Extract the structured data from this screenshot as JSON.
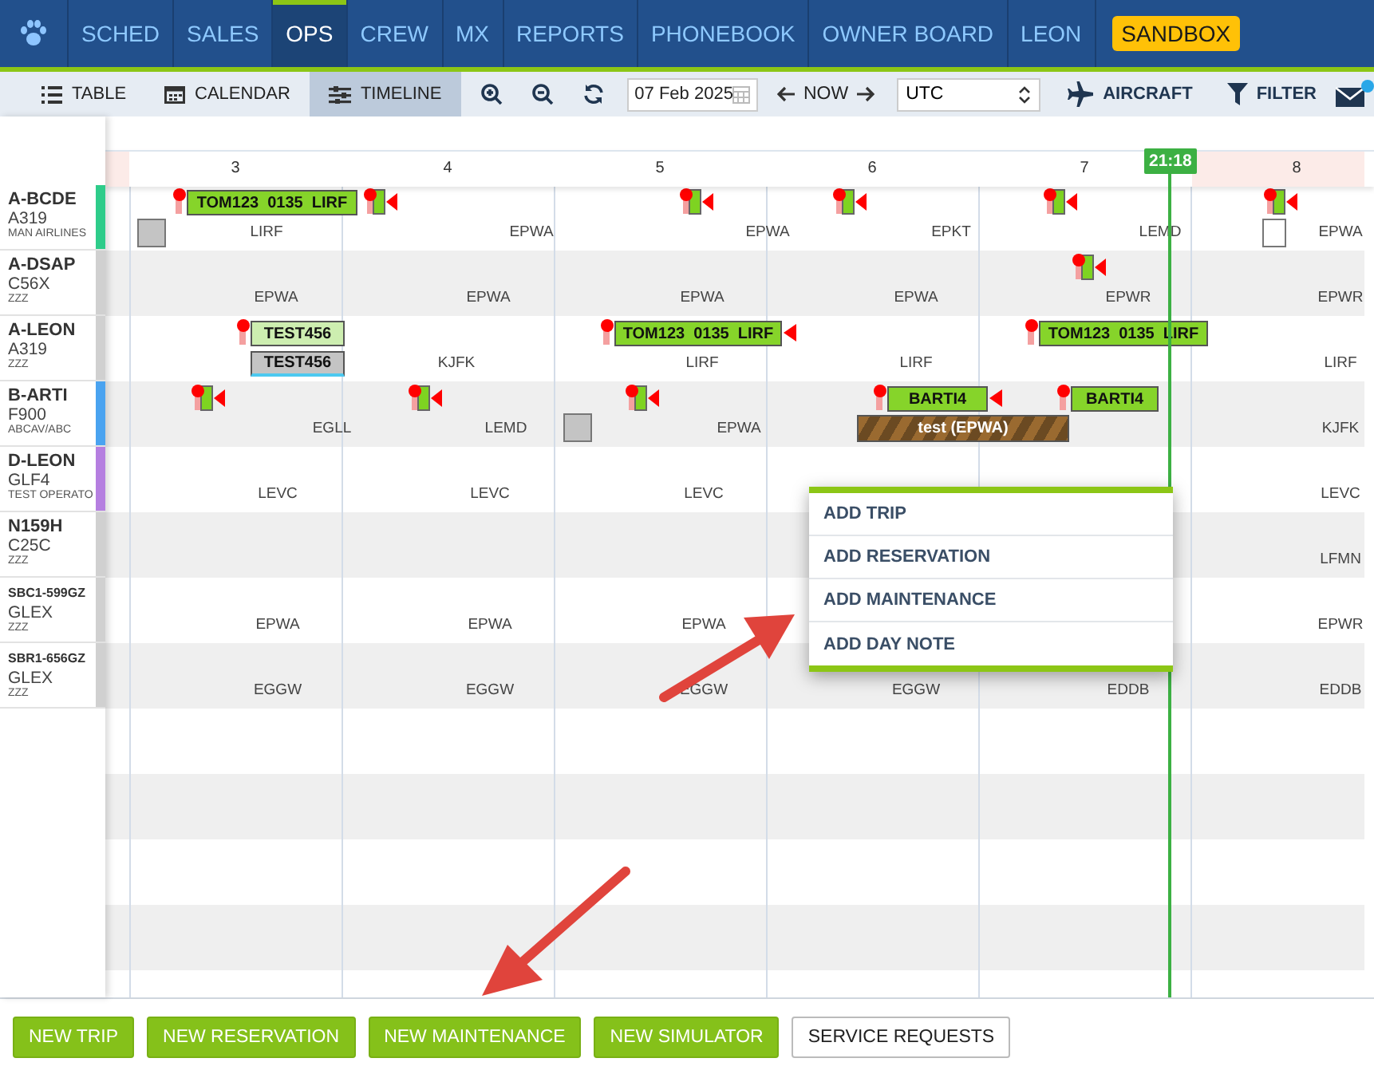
{
  "nav": {
    "items": [
      {
        "label": "SCHED",
        "selected": false
      },
      {
        "label": "SALES",
        "selected": false
      },
      {
        "label": "OPS",
        "selected": true
      },
      {
        "label": "CREW",
        "selected": false
      },
      {
        "label": "MX",
        "selected": false
      },
      {
        "label": "REPORTS",
        "selected": false
      },
      {
        "label": "PHONEBOOK",
        "selected": false
      },
      {
        "label": "OWNER BOARD",
        "selected": false
      },
      {
        "label": "LEON",
        "selected": false
      }
    ],
    "badge": "SANDBOX"
  },
  "toolbar": {
    "views": [
      {
        "label": "TABLE",
        "kind": "list",
        "selected": false
      },
      {
        "label": "CALENDAR",
        "kind": "calendar",
        "selected": false
      },
      {
        "label": "TIMELINE",
        "kind": "timeline",
        "selected": true
      }
    ],
    "date": "07 Feb 2025",
    "now": "NOW",
    "timezone": "UTC",
    "aircraft": "AIRCRAFT",
    "filter": "FILTER"
  },
  "timeline": {
    "days": [
      "3",
      "4",
      "5",
      "6",
      "7",
      "8"
    ],
    "now": "21:18",
    "aircraft": [
      {
        "reg": "A-BCDE",
        "type": "A319",
        "operator": "MAN AIRLINES",
        "color": "#2ecc8a",
        "airports": [
          "LIRF",
          "EPWA",
          "EPWA",
          "EPKT",
          "LEMD",
          "EPWA"
        ],
        "trips": [
          {
            "label": "TOM123  0135  LIRF",
            "kind": "confirmed"
          }
        ]
      },
      {
        "reg": "A-DSAP",
        "type": "C56X",
        "operator": "ZZZ",
        "color": "#d0d0d0",
        "airports": [
          "EPWA",
          "EPWA",
          "EPWA",
          "EPWA",
          "EPWR",
          "EPWR"
        ]
      },
      {
        "reg": "A-LEON",
        "type": "A319",
        "operator": "ZZZ",
        "color": "#d0d0d0",
        "airports": [
          "KJFK",
          "LIRF",
          "LIRF",
          "LIRF"
        ],
        "trips": [
          {
            "label": "TEST456",
            "kind": "option"
          },
          {
            "label": "TEST456",
            "kind": "draft"
          },
          {
            "label": "TOM123  0135  LIRF",
            "kind": "confirmed"
          },
          {
            "label": "TOM123  0135  LIRF",
            "kind": "confirmed"
          }
        ]
      },
      {
        "reg": "B-ARTI",
        "type": "F900",
        "operator": "ABCAV/ABC",
        "color": "#4aa3f0",
        "airports": [
          "EGLL",
          "LEMD",
          "EPWA",
          "KJFK"
        ],
        "trips": [
          {
            "label": "BARTI4",
            "kind": "confirmed"
          },
          {
            "label": "BARTI4",
            "kind": "confirmed"
          },
          {
            "label": "test (EPWA)",
            "kind": "maintenance"
          }
        ]
      },
      {
        "reg": "D-LEON",
        "type": "GLF4",
        "operator": "TEST OPERATO",
        "color": "#b57fe0",
        "airports": [
          "LEVC",
          "LEVC",
          "LEVC",
          "LEVC"
        ]
      },
      {
        "reg": "N159H",
        "type": "C25C",
        "operator": "ZZZ",
        "color": "#d0d0d0",
        "airports": [
          "LFMN"
        ]
      },
      {
        "reg": "SBC1-599GZ",
        "type": "GLEX",
        "operator": "ZZZ",
        "color": "#d0d0d0",
        "airports": [
          "EPWA",
          "EPWA",
          "EPWA",
          "EPWR"
        ]
      },
      {
        "reg": "SBR1-656GZ",
        "type": "GLEX",
        "operator": "ZZZ",
        "color": "#d0d0d0",
        "airports": [
          "EGGW",
          "EGGW",
          "EGGW",
          "EGGW",
          "EDDB",
          "EDDB"
        ]
      }
    ]
  },
  "context_menu": [
    "ADD TRIP",
    "ADD RESERVATION",
    "ADD MAINTENANCE",
    "ADD DAY NOTE"
  ],
  "buttons": [
    {
      "label": "NEW TRIP",
      "kind": "primary"
    },
    {
      "label": "NEW RESERVATION",
      "kind": "primary"
    },
    {
      "label": "NEW MAINTENANCE",
      "kind": "primary"
    },
    {
      "label": "NEW SIMULATOR",
      "kind": "primary"
    },
    {
      "label": "SERVICE REQUESTS",
      "kind": "secondary"
    }
  ]
}
